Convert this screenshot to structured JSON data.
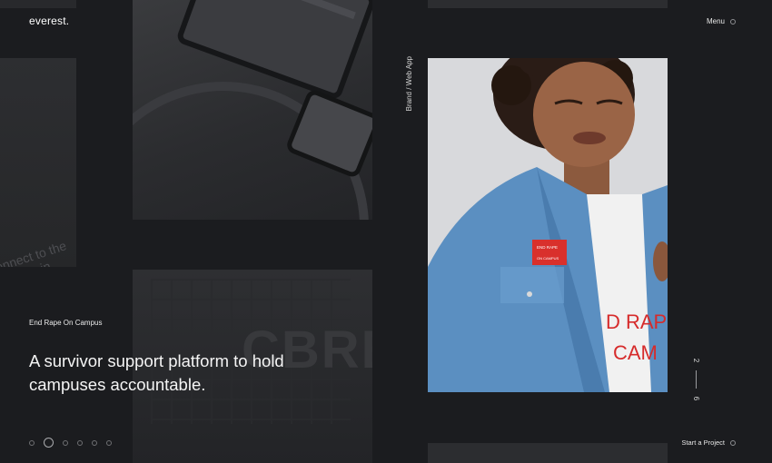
{
  "brand": {
    "logo": "everest."
  },
  "header": {
    "menu_label": "Menu"
  },
  "slide": {
    "category": "Brand / Web App",
    "project_name": "End Rape On Campus",
    "headline": "A survivor support platform to hold campuses accountable.",
    "current": "2",
    "total": "6",
    "badge_line1": "END RAPE",
    "badge_line2": "ON CAMPUS",
    "shirt_line1": "D RAP",
    "shirt_line2": "CAM"
  },
  "tiles": {
    "faint_line1": "onnect to the",
    "faint_line2": "Mountain",
    "building_word": "CBRE"
  },
  "footer": {
    "cta_label": "Start a Project"
  },
  "pagination": {
    "count": 6,
    "active_index": 1
  },
  "colors": {
    "background": "#1b1c1f",
    "badge": "#d9302c",
    "denim": "#5b8fc1"
  }
}
